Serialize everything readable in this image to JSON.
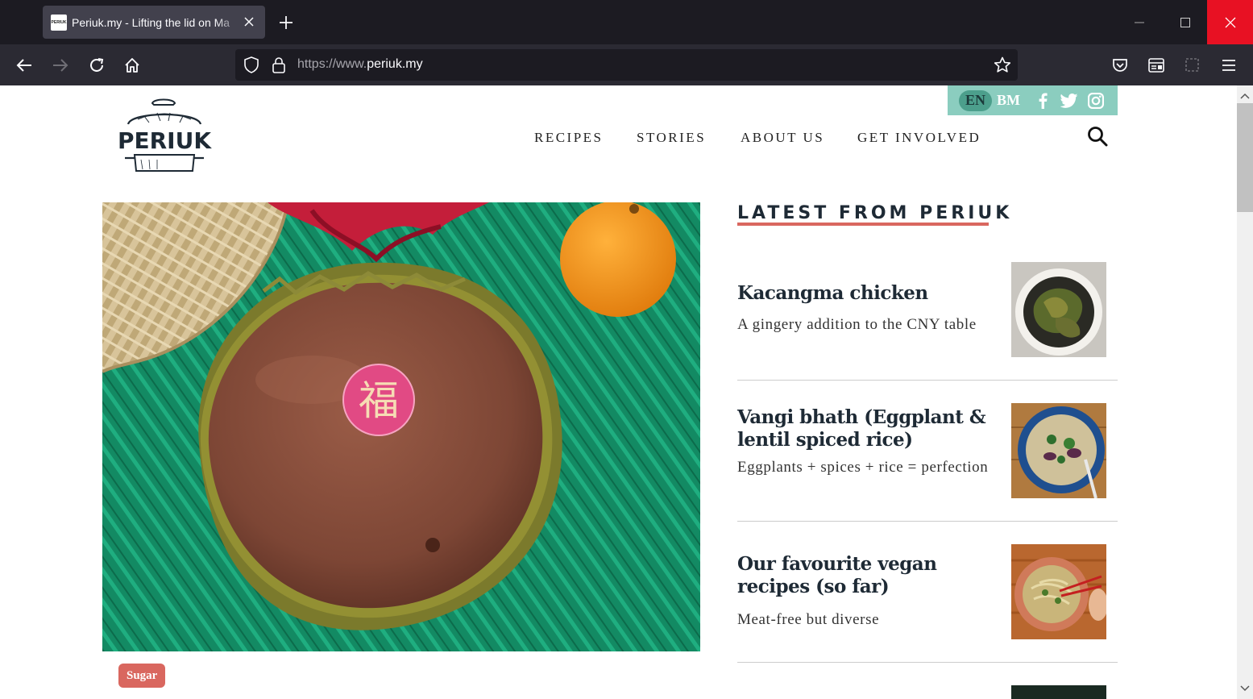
{
  "browser": {
    "tab_title": "Periuk.my - Lifting the lid on Ma",
    "tab_favicon_text": "PERIUK",
    "url_prefix": "https://www.",
    "url_domain": "periuk.my"
  },
  "header": {
    "lang_en": "EN",
    "lang_bm": "BM",
    "nav": [
      "RECIPES",
      "STORIES",
      "ABOUT US",
      "GET INVOLVED"
    ],
    "logo_text": "PERIUK"
  },
  "hero": {
    "tag": "Sugar",
    "badge_char": "福"
  },
  "latest": {
    "heading": "LATEST FROM PERIUK",
    "articles": [
      {
        "title": "Kacangma chicken",
        "subtitle": "A gingery addition to the CNY table"
      },
      {
        "title": "Vangi bhath (Eggplant & lentil spiced rice)",
        "subtitle": "Eggplants + spices + rice = perfection"
      },
      {
        "title": "Our favourite vegan recipes (so far)",
        "subtitle": "Meat-free but diverse"
      }
    ]
  },
  "colors": {
    "accent": "#d9675f",
    "lang_bar": "#8bcdbf",
    "text_dark": "#1e2a35"
  }
}
